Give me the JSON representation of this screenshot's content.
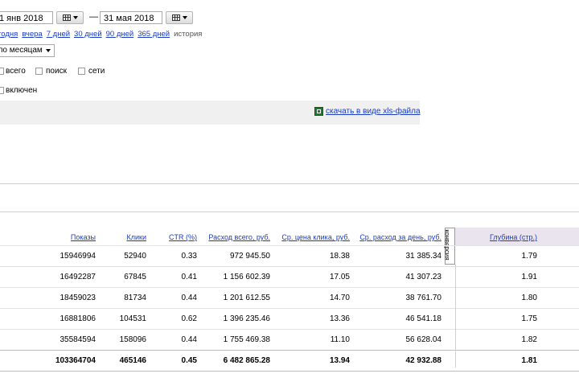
{
  "period": {
    "from_date": "1 янв 2018",
    "separator": "—",
    "to_date": "31 мая 2018"
  },
  "quick_ranges": [
    "сегодня",
    "вчера",
    "7 дней",
    "30 дней",
    "90 дней",
    "365 дней"
  ],
  "history_label": "история",
  "grouping_select": {
    "value": "по месяцам"
  },
  "filters": [
    {
      "label": "всего",
      "checked": false
    },
    {
      "label": "поиск",
      "checked": false
    },
    {
      "label": "сети",
      "checked": false
    }
  ],
  "option_enabled": {
    "label": "включен"
  },
  "download_link": "скачать в виде xls-файла",
  "table": {
    "columns": [
      "Показы",
      "Клики",
      "CTR (%)",
      "Расход всего, руб.",
      "Ср. цена клика, руб.",
      "Ср. расход за день, руб.",
      "Глубина (стр.)"
    ],
    "hidden_column_label": "конверсия",
    "rows": [
      [
        "15946994",
        "52940",
        "0.33",
        "972 945.50",
        "18.38",
        "31 385.34",
        "1.79"
      ],
      [
        "16492287",
        "67845",
        "0.41",
        "1 156 602.39",
        "17.05",
        "41 307.23",
        "1.91"
      ],
      [
        "18459023",
        "81734",
        "0.44",
        "1 201 612.55",
        "14.70",
        "38 761.70",
        "1.80"
      ],
      [
        "16881806",
        "104531",
        "0.62",
        "1 396 235.46",
        "13.36",
        "46 541.18",
        "1.75"
      ],
      [
        "35584594",
        "158096",
        "0.44",
        "1 755 469.38",
        "11.10",
        "56 628.04",
        "1.82"
      ]
    ],
    "total": [
      "103364704",
      "465146",
      "0.45",
      "6 482 865.28",
      "13.94",
      "42 932.88",
      "1.81"
    ]
  },
  "colors": {
    "link": "#1a3dc1",
    "highlight": "#e9e4ee",
    "panel": "#f0f0f0"
  },
  "icons": [
    "calendar-icon",
    "dropdown-arrow-icon",
    "xls-file-icon"
  ]
}
